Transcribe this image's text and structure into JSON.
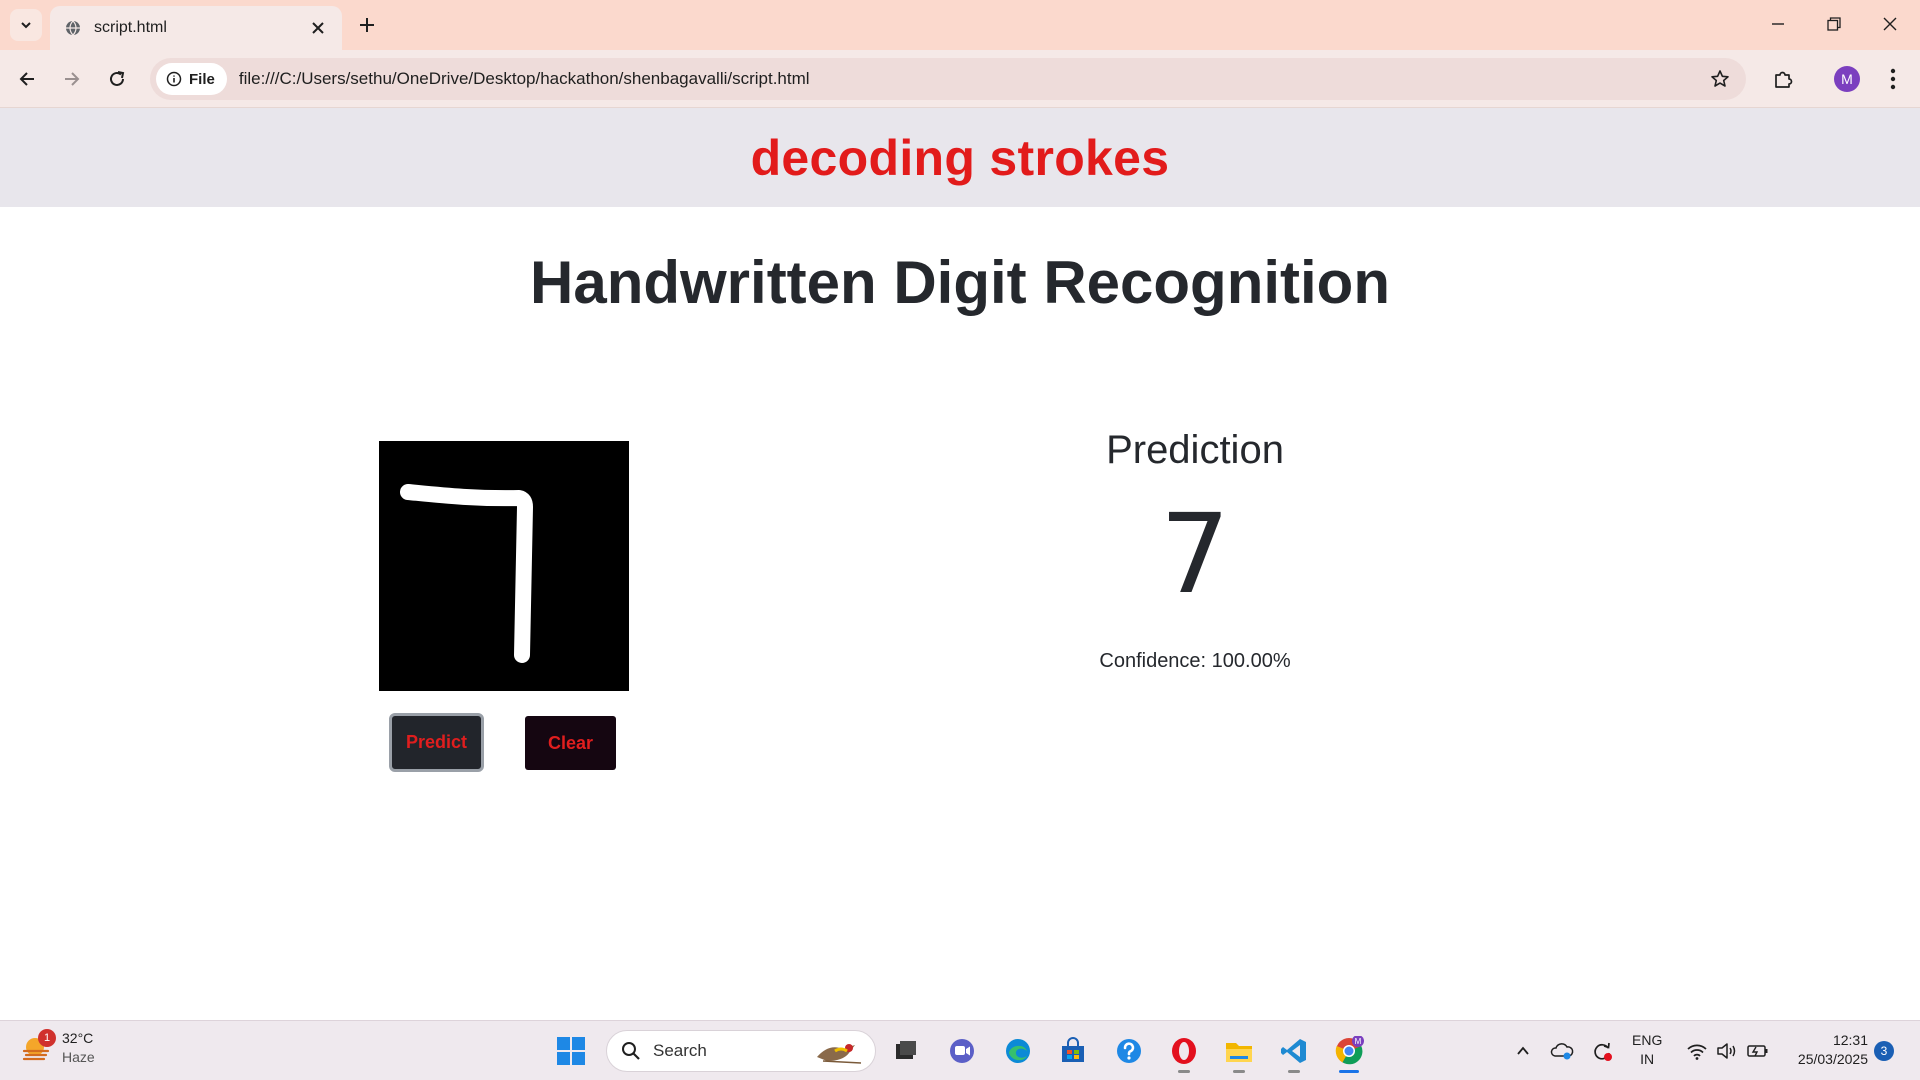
{
  "browser": {
    "tab": {
      "title": "script.html"
    },
    "address": {
      "scheme_label": "File",
      "url": "file:///C:/Users/sethu/OneDrive/Desktop/hackathon/shenbagavalli/script.html"
    },
    "profile_initial": "M"
  },
  "page": {
    "brand": "decoding strokes",
    "title": "Handwritten Digit Recognition",
    "buttons": {
      "predict": "Predict",
      "clear": "Clear"
    },
    "prediction": {
      "label": "Prediction",
      "digit": "7",
      "confidence": "Confidence: 100.00%"
    },
    "canvas_drawing": "digit-seven-stroke"
  },
  "taskbar": {
    "weather": {
      "temp": "32°C",
      "condition": "Haze",
      "badge": "1"
    },
    "search_placeholder": "Search",
    "language": {
      "line1": "ENG",
      "line2": "IN"
    },
    "clock": {
      "time": "12:31",
      "date": "25/03/2025"
    },
    "notifications": "3",
    "apps": [
      "task-view-icon",
      "teams-icon",
      "edge-icon",
      "store-icon",
      "help-icon",
      "opera-icon",
      "file-explorer-icon",
      "vscode-icon",
      "chrome-icon"
    ]
  },
  "colors": {
    "brand_red": "#e21b1b",
    "tab_strip": "#fbd9cd",
    "toolbar": "#f5e9e7",
    "header_band": "#e8e6ec",
    "text_dark": "#25282d"
  }
}
